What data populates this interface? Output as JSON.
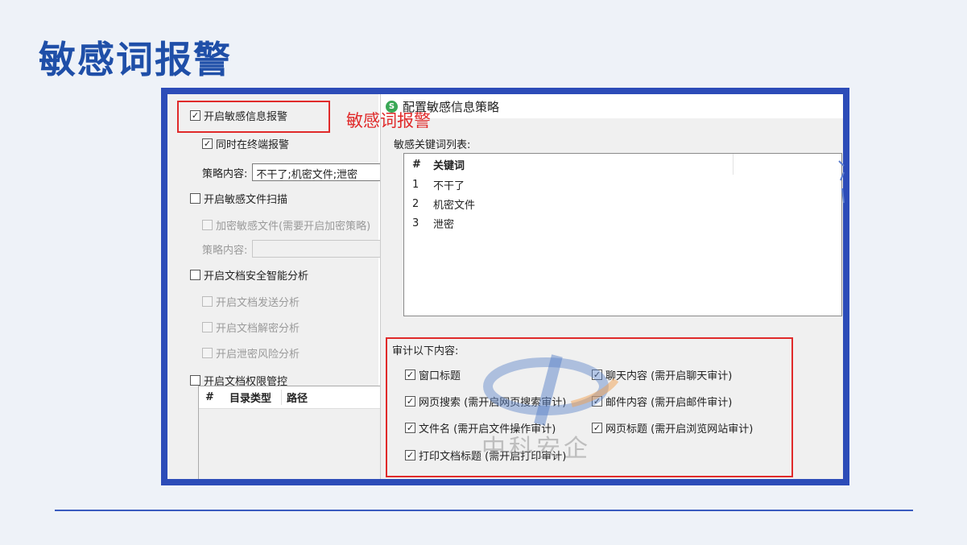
{
  "slide_title": "敏感词报警",
  "annotation_label": "敏感词报警",
  "left_panel": {
    "enable_sensitive_alert": "开启敏感信息报警",
    "alert_on_terminal": "同时在终端报警",
    "policy_content_label": "策略内容:",
    "policy_content_value": "不干了;机密文件;泄密",
    "enable_file_scan": "开启敏感文件扫描",
    "encrypt_sensitive": "加密敏感文件(需要开启加密策略)",
    "policy_content_label2": "策略内容:",
    "policy_content_value2": "",
    "enable_doc_analysis": "开启文档安全智能分析",
    "doc_send_analysis": "开启文档发送分析",
    "doc_decrypt_analysis": "开启文档解密分析",
    "leak_risk_analysis": "开启泄密风险分析",
    "enable_doc_permission": "开启文档权限管控",
    "dir_table_headers": [
      "#",
      "目录类型",
      "路径"
    ]
  },
  "dialog": {
    "title": "配置敏感信息策略",
    "icon": "app-logo-icon",
    "keyword_list_label": "敏感关键词列表:",
    "keyword_headers": [
      "#",
      "关键词"
    ],
    "keywords": [
      {
        "num": "1",
        "word": "不干了"
      },
      {
        "num": "2",
        "word": "机密文件"
      },
      {
        "num": "3",
        "word": "泄密"
      }
    ],
    "audit_label": "审计以下内容:",
    "audit_items": [
      "窗口标题",
      "聊天内容 (需开启聊天审计)",
      "网页搜索 (需开启网页搜索审计)",
      "邮件内容 (需开启邮件审计)",
      "文件名 (需开启文件操作审计)",
      "网页标题 (需开启浏览网站审计)",
      "打印文档标题 (需开启打印审计)"
    ]
  },
  "watermark_text": "中科安企",
  "colors": {
    "title_blue": "#1f4fa8",
    "frame_blue": "#2c4cb8",
    "highlight_red": "#e02a2a"
  }
}
